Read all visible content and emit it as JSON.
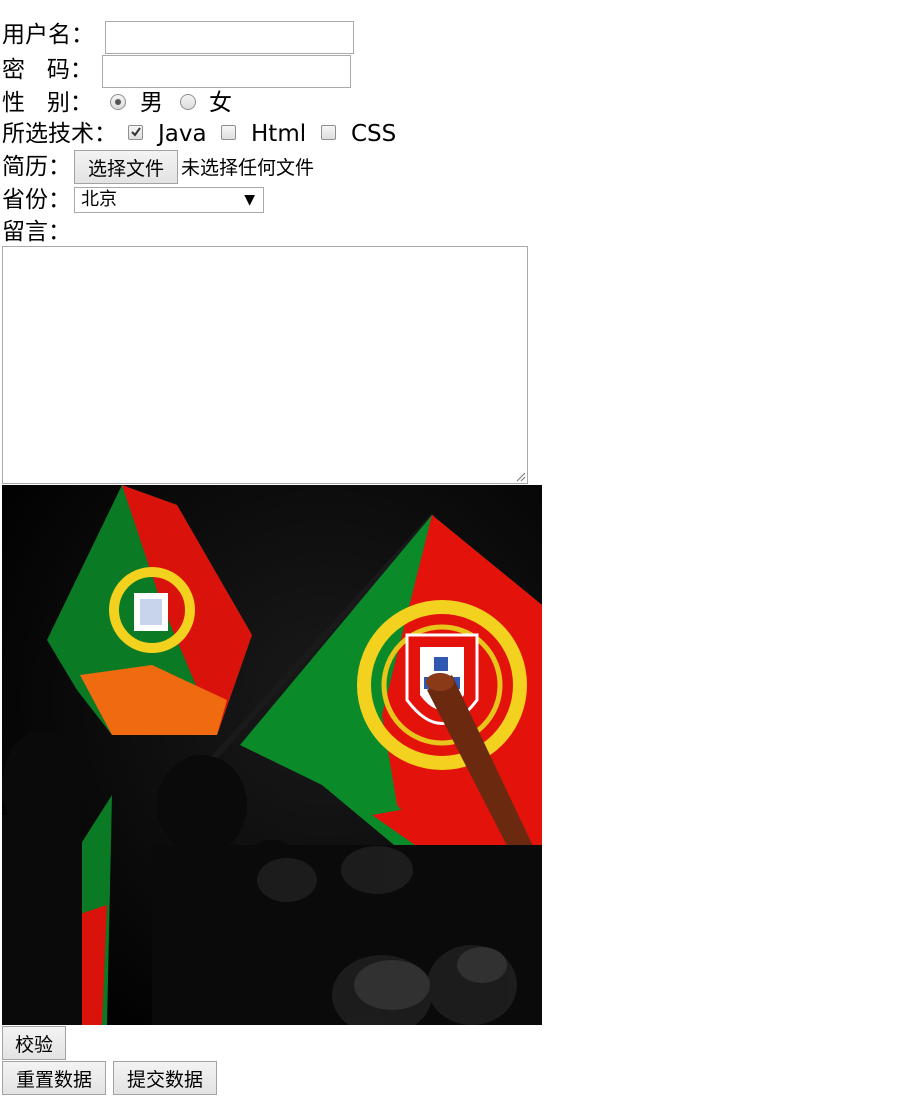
{
  "form": {
    "username_label": "用户名：",
    "username_value": "",
    "password_label": "密   码：",
    "password_value": "",
    "gender_label": "性   别：",
    "gender_options": [
      {
        "label": "男",
        "checked": true
      },
      {
        "label": "女",
        "checked": false
      }
    ],
    "tech_label": "所选技术：",
    "tech_options": [
      {
        "label": "Java",
        "checked": true
      },
      {
        "label": "Html",
        "checked": false
      },
      {
        "label": "CSS",
        "checked": false
      }
    ],
    "resume_label": "简历：",
    "file_button_label": "选择文件",
    "file_status": "未选择任何文件",
    "province_label": "省份：",
    "province_selected": "北京",
    "message_label": "留言：",
    "message_value": ""
  },
  "photo": {
    "subject": "portugal-flags-crowd-photo"
  },
  "buttons": {
    "validate_label": "校验",
    "reset_label": "重置数据",
    "submit_label": "提交数据"
  },
  "colors": {
    "flag_green": "#0b8a2a",
    "flag_red": "#e3120b",
    "emblem_yellow": "#f2d21e"
  }
}
